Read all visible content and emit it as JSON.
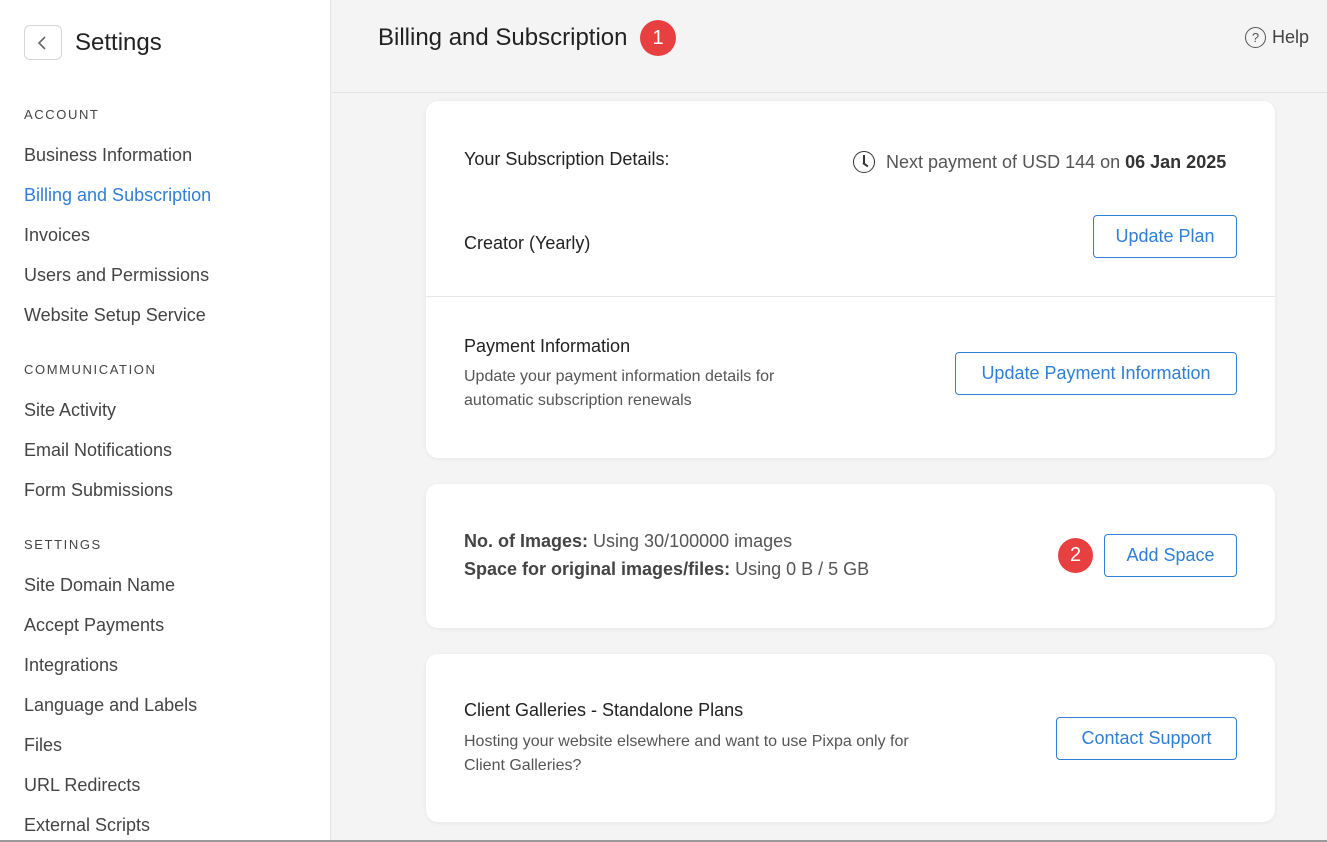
{
  "sidebar": {
    "title": "Settings",
    "sections": [
      {
        "heading": "ACCOUNT",
        "items": [
          "Business Information",
          "Billing and Subscription",
          "Invoices",
          "Users and Permissions",
          "Website Setup Service"
        ]
      },
      {
        "heading": "COMMUNICATION",
        "items": [
          "Site Activity",
          "Email Notifications",
          "Form Submissions"
        ]
      },
      {
        "heading": "SETTINGS",
        "items": [
          "Site Domain Name",
          "Accept Payments",
          "Integrations",
          "Language and Labels",
          "Files",
          "URL Redirects",
          "External Scripts"
        ]
      }
    ],
    "active_item": "Billing and Subscription"
  },
  "header": {
    "title": "Billing and Subscription",
    "badge": "1",
    "help_label": "Help",
    "help_icon": "question-circle-icon"
  },
  "subscription": {
    "heading": "Your Subscription Details:",
    "next_payment_prefix": "Next payment of USD 144 on",
    "next_payment_date": "06 Jan 2025",
    "plan": "Creator (Yearly)",
    "update_plan_label": "Update Plan"
  },
  "payment": {
    "heading": "Payment Information",
    "desc_line1": "Update your payment information details for",
    "desc_line2": "automatic subscription renewals",
    "button_label": "Update Payment Information"
  },
  "storage": {
    "images_label": "No. of Images:",
    "images_value": "Using 30/100000 images",
    "space_label": "Space for original images/files:",
    "space_value": "Using 0 B / 5 GB",
    "badge": "2",
    "button_label": "Add Space"
  },
  "galleries": {
    "heading": "Client Galleries - Standalone Plans",
    "desc_line1": "Hosting your website elsewhere and want to use Pixpa only for",
    "desc_line2": "Client Galleries?",
    "button_label": "Contact Support"
  },
  "colors": {
    "accent": "#2f7fd6",
    "badge": "#e84040"
  }
}
